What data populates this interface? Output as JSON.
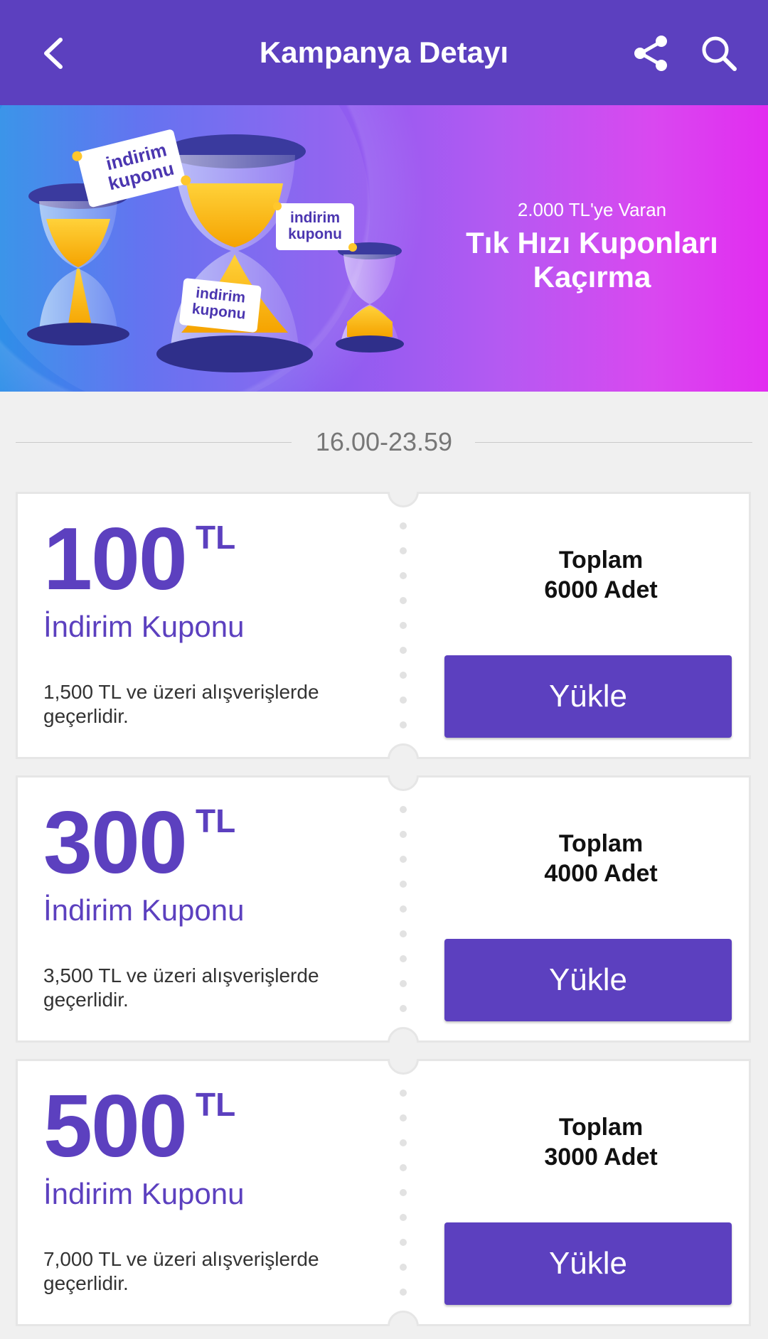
{
  "header": {
    "title": "Kampanya Detayı",
    "back_icon": "back-arrow-icon",
    "share_icon": "share-icon",
    "search_icon": "search-icon"
  },
  "banner": {
    "subtitle": "2.000 TL'ye Varan",
    "headline_line1": "Tık Hızı Kuponları",
    "headline_line2": "Kaçırma",
    "tag_text_line1": "indirim",
    "tag_text_line2": "kuponu"
  },
  "time_range": "16.00-23.59",
  "coupons": [
    {
      "amount": "100",
      "currency": "TL",
      "label": "İndirim Kuponu",
      "condition_line1": "1,500 TL ve üzeri alışverişlerde",
      "condition_line2": "geçerlidir.",
      "total_line1": "Toplam",
      "total_line2": "6000 Adet",
      "button": "Yükle"
    },
    {
      "amount": "300",
      "currency": "TL",
      "label": "İndirim Kuponu",
      "condition_line1": "3,500 TL ve üzeri alışverişlerde",
      "condition_line2": "geçerlidir.",
      "total_line1": "Toplam",
      "total_line2": "4000 Adet",
      "button": "Yükle"
    },
    {
      "amount": "500",
      "currency": "TL",
      "label": "İndirim Kuponu",
      "condition_line1": "7,000 TL ve üzeri alışverişlerde",
      "condition_line2": "geçerlidir.",
      "total_line1": "Toplam",
      "total_line2": "3000 Adet",
      "button": "Yükle"
    }
  ],
  "colors": {
    "brand": "#5c40bf",
    "background": "#f0f0f0",
    "banner_gradient_start": "#2f8fe8",
    "banner_gradient_end": "#e22cf0"
  }
}
